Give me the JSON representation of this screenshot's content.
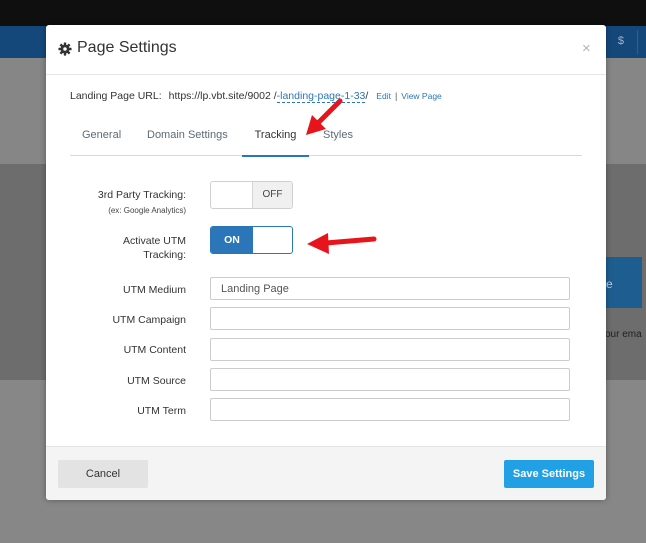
{
  "background": {
    "nav_icon": "$",
    "block_text": "e",
    "side_text": "our ema"
  },
  "modal": {
    "title": "Page Settings",
    "title_icon": "gear-icon",
    "close_symbol": "×"
  },
  "url_row": {
    "label": "Landing Page URL:",
    "base": "https://lp.vbt.site/9002 /",
    "slug": "-landing-page-1-33",
    "trailing": "/",
    "edit_label": "Edit",
    "separator": "|",
    "view_label": "View Page"
  },
  "tabs": {
    "items": [
      {
        "label": "General"
      },
      {
        "label": "Domain Settings"
      },
      {
        "label": "Tracking"
      },
      {
        "label": "Styles"
      }
    ],
    "active": "Tracking"
  },
  "fields": {
    "third_party": {
      "label": "3rd Party Tracking:",
      "sublabel": "(ex: Google Analytics)",
      "state_label": "OFF",
      "enabled": false
    },
    "activate_utm": {
      "label_line1": "Activate UTM",
      "label_line2": "Tracking:",
      "state_label": "ON",
      "enabled": true
    },
    "utm_medium": {
      "label": "UTM Medium",
      "value": "Landing Page"
    },
    "utm_campaign": {
      "label": "UTM Campaign",
      "value": ""
    },
    "utm_content": {
      "label": "UTM Content",
      "value": ""
    },
    "utm_source": {
      "label": "UTM Source",
      "value": ""
    },
    "utm_term": {
      "label": "UTM Term",
      "value": ""
    }
  },
  "footer": {
    "cancel_label": "Cancel",
    "save_label": "Save Settings"
  },
  "colors": {
    "accent": "#2a76b8",
    "save_button": "#22a0e6",
    "annotation_arrow": "#e8141c"
  }
}
